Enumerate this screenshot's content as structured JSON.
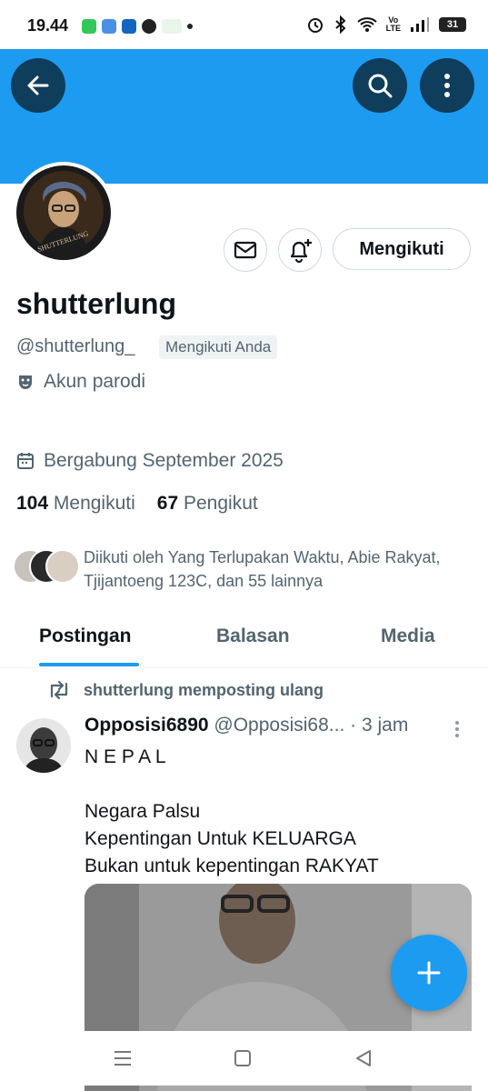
{
  "status_bar": {
    "time": "19.44",
    "volte_top": "Vo",
    "volte_bottom": "LTE",
    "battery": "31"
  },
  "profile": {
    "display_name": "shutterlung",
    "handle": "@shutterlung_",
    "follows_you_badge": "Mengikuti Anda",
    "parody_label": "Akun parodi",
    "joined": "Bergabung September 2025",
    "following_count": "104",
    "following_label": "Mengikuti",
    "followers_count": "67",
    "followers_label": "Pengikut",
    "followed_by": "Diikuti oleh Yang Terlupakan Waktu, Abie Rakyat, Tjijantoeng 123C, dan 55 lainnya",
    "follow_button_label": "Mengikuti",
    "avatar_caption": "SHUTTERLUNG"
  },
  "tabs": [
    {
      "label": "Postingan",
      "active": true
    },
    {
      "label": "Balasan",
      "active": false
    },
    {
      "label": "Media",
      "active": false
    }
  ],
  "post": {
    "repost_label": "shutterlung memposting ulang",
    "author": "Opposisi6890",
    "author_handle": "@Opposisi68...",
    "time": "· 3 jam",
    "text": "N E P A L\n\nNegara Palsu\nKepentingan Untuk KELUARGA\nBukan untuk kepentingan RAKYAT"
  },
  "colors": {
    "accent": "#1d9bf0",
    "banner": "#1d9bf0",
    "header_buttons": "#0f3d5c",
    "secondary_text": "#536471"
  },
  "icons": {
    "back": "arrow-left-icon",
    "search": "search-icon",
    "more": "more-vertical-icon",
    "message": "envelope-icon",
    "notify": "bell-plus-icon",
    "parody": "mask-icon",
    "joined": "calendar-icon",
    "repost": "repost-icon",
    "compose": "plus-icon"
  }
}
